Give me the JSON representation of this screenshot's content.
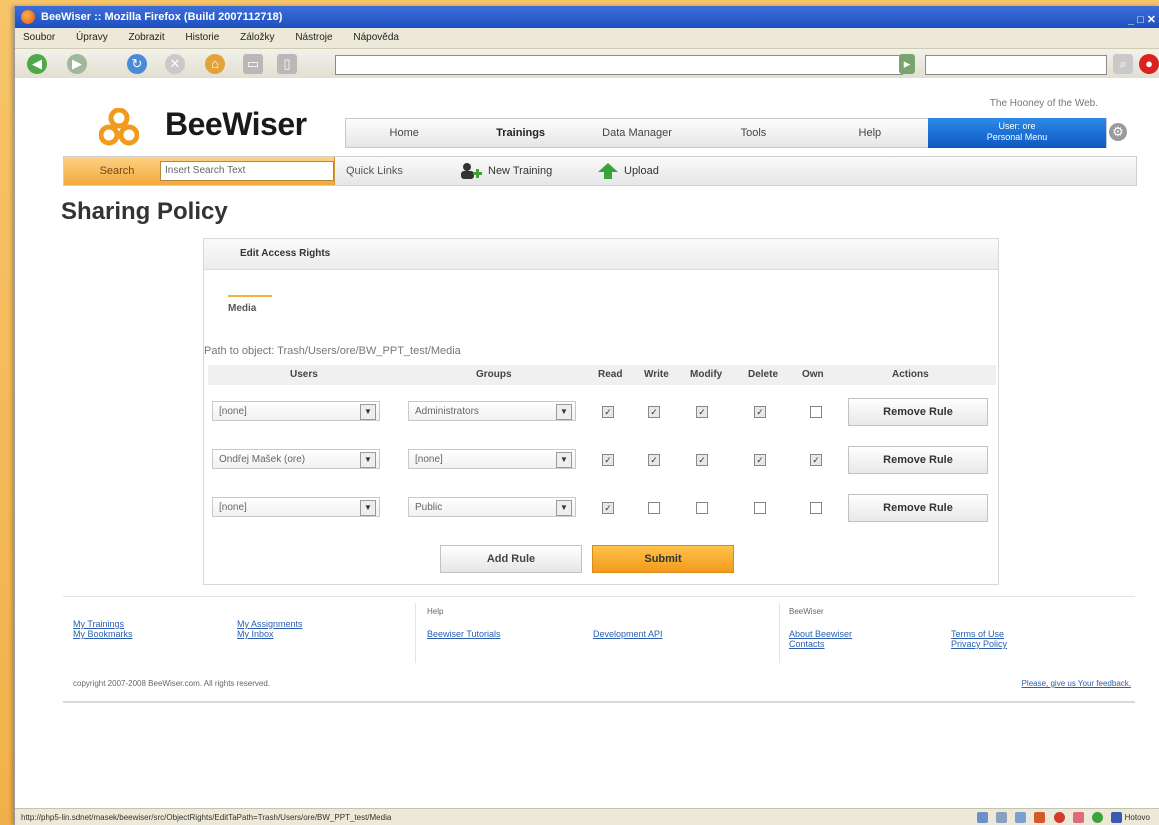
{
  "window": {
    "title": "BeeWiser :: Mozilla Firefox (Build 2007112718)"
  },
  "menubar": {
    "items": [
      "Soubor",
      "Úpravy",
      "Zobrazit",
      "Historie",
      "Záložky",
      "Nástroje",
      "Nápověda"
    ]
  },
  "header": {
    "logo_text": "BeeWiser",
    "slogan": "The Hooney of the Web.",
    "nav": [
      "Home",
      "Trainings",
      "Data Manager",
      "Tools",
      "Help"
    ],
    "user_label": "User: ore",
    "user_sub": "Personal Menu"
  },
  "subbar": {
    "search_label": "Search",
    "search_placeholder": "Insert Search Text",
    "quick_links": "Quick Links",
    "new_training": "New Training",
    "upload": "Upload"
  },
  "page": {
    "title": "Sharing Policy",
    "panel_title": "Edit Access Rights",
    "tab": "Media",
    "path": "Path to object: Trash/Users/ore/BW_PPT_test/Media",
    "columns": [
      "Users",
      "Groups",
      "Read",
      "Write",
      "Modify",
      "Delete",
      "Own",
      "Actions"
    ],
    "rows": [
      {
        "user": "[none]",
        "group": "Administrators",
        "read": true,
        "write": true,
        "modify": true,
        "delete": true,
        "own": false,
        "action": "Remove Rule"
      },
      {
        "user": "Ondřej Mašek (ore)",
        "group": "[none]",
        "read": true,
        "write": true,
        "modify": true,
        "delete": true,
        "own": true,
        "action": "Remove Rule"
      },
      {
        "user": "[none]",
        "group": "Public",
        "read": true,
        "write": false,
        "modify": false,
        "delete": false,
        "own": false,
        "action": "Remove Rule"
      }
    ],
    "add_rule": "Add Rule",
    "submit": "Submit"
  },
  "footer": {
    "col1": [
      "My Trainings",
      "My Bookmarks"
    ],
    "col2": [
      "My Assignments",
      "My Inbox"
    ],
    "help_heading": "Help",
    "help_links": [
      "Beewiser Tutorials",
      "Development API"
    ],
    "beewiser_heading": "BeeWiser",
    "about_links": [
      "About Beewiser",
      "Contacts"
    ],
    "legal_links": [
      "Terms of Use",
      "Privacy Policy"
    ],
    "copyright": "copyright 2007-2008 BeeWiser.com. All rights reserved.",
    "feedback": "Please, give us Your feedback."
  },
  "status": {
    "url": "http://php5-lin.sdnet/masek/beewiser/src/ObjectRights/EditTaPath=Trash/Users/ore/BW_PPT_test/Media",
    "right": "Hotovo"
  }
}
